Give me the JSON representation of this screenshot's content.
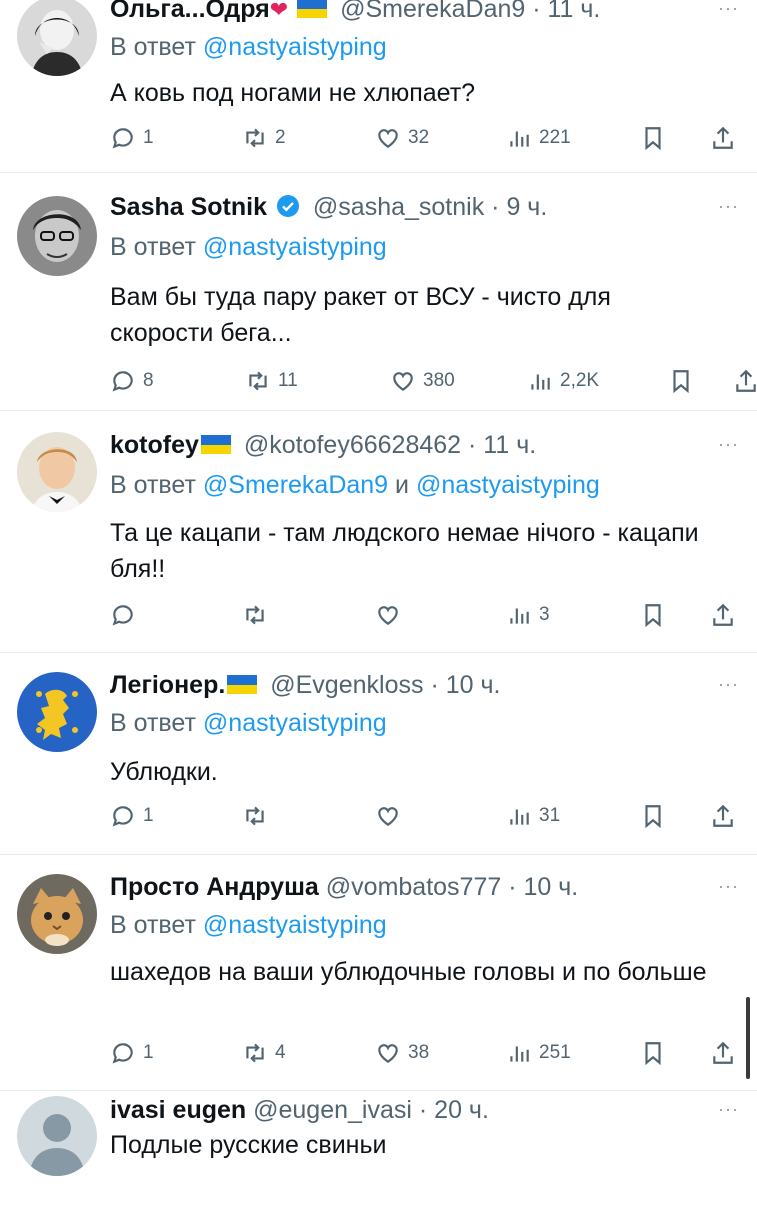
{
  "tweets": [
    {
      "name": "Ольга...Одря",
      "emoji": "❤",
      "handle": "@SmerekaDan9",
      "time": "· 11 ч.",
      "reply_prefix": "В ответ",
      "reply_to": "@nastyaistyping",
      "reply_and": "",
      "reply_to2": "",
      "text": "А ковь под ногами не хлюпает?",
      "counts": {
        "reply": "1",
        "retweet": "2",
        "like": "32",
        "views": "221"
      }
    },
    {
      "name": "Sasha Sotnik",
      "handle": "@sasha_sotnik",
      "time": "· 9 ч.",
      "reply_prefix": "В ответ",
      "reply_to": "@nastyaistyping",
      "text": "Вам бы туда пару ракет от ВСУ - чисто для скорости бега...",
      "counts": {
        "reply": "8",
        "retweet": "11",
        "like": "380",
        "views": "2,2K"
      }
    },
    {
      "name": "kotofey",
      "handle": "@kotofey66628462",
      "time": "· 11 ч.",
      "reply_prefix": "В ответ",
      "reply_to": "@SmerekaDan9",
      "reply_and": "и",
      "reply_to2": "@nastyaistyping",
      "text": "Та це кацапи - там людского немае нічого - кацапи бля!!",
      "counts": {
        "reply": "",
        "retweet": "",
        "like": "",
        "views": "3"
      }
    },
    {
      "name": "Легіонер.",
      "handle": "@Evgenkloss",
      "time": "· 10 ч.",
      "reply_prefix": "В ответ",
      "reply_to": "@nastyaistyping",
      "text": "Ублюдки.",
      "counts": {
        "reply": "1",
        "retweet": "",
        "like": "",
        "views": "31"
      }
    },
    {
      "name": "Просто Андруша",
      "handle": "@vombatos777",
      "time": "· 10 ч.",
      "reply_prefix": "В ответ",
      "reply_to": "@nastyaistyping",
      "text": "шахедов на ваши ублюдочные головы и по больше",
      "counts": {
        "reply": "1",
        "retweet": "4",
        "like": "38",
        "views": "251"
      }
    },
    {
      "name": "ivasi eugen",
      "handle": "@eugen_ivasi",
      "time": "· 20 ч.",
      "text": "Подлые русские свиньи"
    }
  ],
  "more_label": "···",
  "colors": {
    "accent": "#1d9bf0",
    "secondary": "#536471",
    "text": "#0f1419",
    "flag_blue": "#1e6fd0",
    "flag_yellow": "#f5d400"
  },
  "icons": {
    "reply": "reply-icon",
    "retweet": "retweet-icon",
    "like": "heart-icon",
    "views": "views-icon",
    "bookmark": "bookmark-icon",
    "share": "share-icon"
  }
}
